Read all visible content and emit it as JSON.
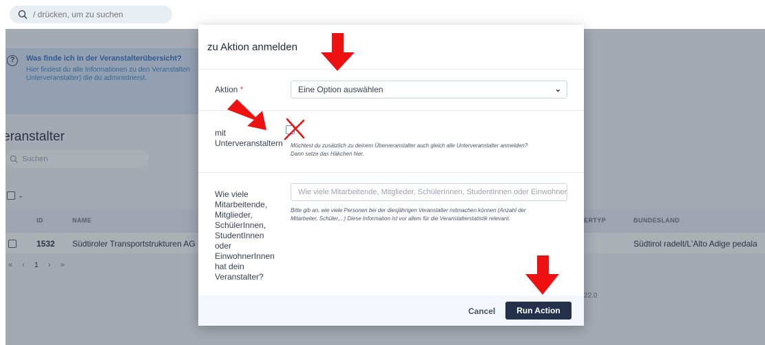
{
  "topbar": {
    "search": {
      "placeholder": "/ drücken, um zu suchen",
      "icon": "search-icon"
    }
  },
  "background": {
    "info": {
      "title": "Was finde ich in der Veranstalterübersicht?",
      "text": "Hier findest du alle Informationen zu den Veranstalten Unterveranstalter) die du administrierst."
    },
    "section_title": "eranstalter",
    "search_placeholder": "Suchen",
    "table": {
      "columns": [
        "ID",
        "NAME",
        "ERTYP",
        "BUNDESLAND"
      ],
      "rows": [
        {
          "id": "1532",
          "name": "Südtiroler Transportstrukturen AG",
          "state": "Südtirol radelt/L'Alto Adige pedala"
        }
      ]
    },
    "pager": {
      "prev_first": "«",
      "prev": "‹",
      "current": "1",
      "next": "›",
      "last": "»"
    },
    "version": "22.0"
  },
  "modal": {
    "title": "zu Aktion anmelden",
    "action": {
      "label": "Aktion",
      "required_mark": "*",
      "value": "Eine Option auswählen",
      "caret_icon": "chevron-down-icon"
    },
    "sub": {
      "label_line1": "mit",
      "label_line2": "Unterveranstaltern",
      "help_line1": "Möchtest du zusätzlich zu deinem Überveranstalter auch gleich alle Unterveranstalter anmelden?",
      "help_line2": "Dann setze das Häkchen hier."
    },
    "count": {
      "label": [
        "Wie viele",
        "Mitarbeitende,",
        "Mitglieder,",
        "SchülerInnen,",
        "StudentInnen",
        "oder",
        "EinwohnerInnen",
        "hat dein",
        "Veranstalter?"
      ],
      "placeholder": "Wie viele Mitarbeitende, Mitglieder, SchülerInnen, StudentInnen oder Einwohner",
      "help_line1": "Bitte gib an, wie viele Personen bei der diesjährigen Veranstalter mitmachen können (Anzahl der",
      "help_line2": "Mitarbeiter, Schüler,...) Diese Information ist vor allem für die Veranstalterstatistik relevant."
    },
    "buttons": {
      "cancel": "Cancel",
      "run": "Run Action"
    }
  },
  "annotations": {
    "arrow_color": "#ee1111",
    "arrows": 3,
    "cross_mark": "x-mark"
  }
}
